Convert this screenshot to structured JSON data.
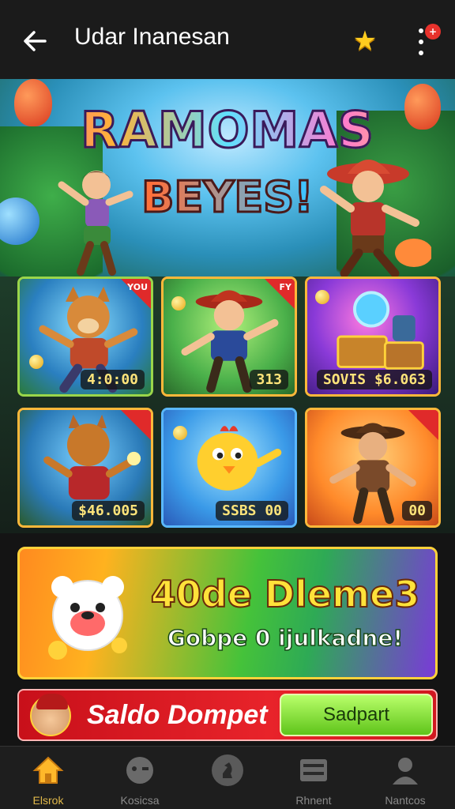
{
  "header": {
    "back_icon": "arrow-left-icon",
    "title": "Udar Inanesan",
    "favorite_icon": "star-icon",
    "menu_icon": "more-vertical-icon",
    "notification_badge": "+"
  },
  "hero": {
    "title": "RAMOMAS",
    "subtitle": "BEYES!"
  },
  "games": [
    {
      "name": "wolf-warrior",
      "price": "4:0:00",
      "corner": "YOU"
    },
    {
      "name": "cowboy-hero",
      "price": "313",
      "corner": "FY"
    },
    {
      "name": "treasure-chest",
      "price": "SOVIS $6.063",
      "corner": ""
    },
    {
      "name": "fox-adventurer",
      "price": "$46.005",
      "corner": ""
    },
    {
      "name": "golden-chicken",
      "price": "SSBS 00",
      "corner": ""
    },
    {
      "name": "desert-ranger",
      "price": "00",
      "corner": ""
    }
  ],
  "promo": {
    "title": "40de Dleme3",
    "subtitle": "Gobpe 0 ijulkadne!"
  },
  "saldo": {
    "label": "Saldo Dompet",
    "button": "Sadpart"
  },
  "nav": [
    {
      "label": "Elsrok",
      "icon": "home-icon",
      "active": true
    },
    {
      "label": "Kosicsa",
      "icon": "game-controller-icon",
      "active": false
    },
    {
      "label": "",
      "icon": "chess-icon",
      "active": false
    },
    {
      "label": "Rhnent",
      "icon": "wallet-icon",
      "active": false
    },
    {
      "label": "Nantcos",
      "icon": "profile-icon",
      "active": false
    }
  ],
  "colors": {
    "accent": "#ffd23a",
    "nav_active": "#e0b84a",
    "saldo_bg": "#e8232a",
    "button_green": "#5fc41a"
  }
}
